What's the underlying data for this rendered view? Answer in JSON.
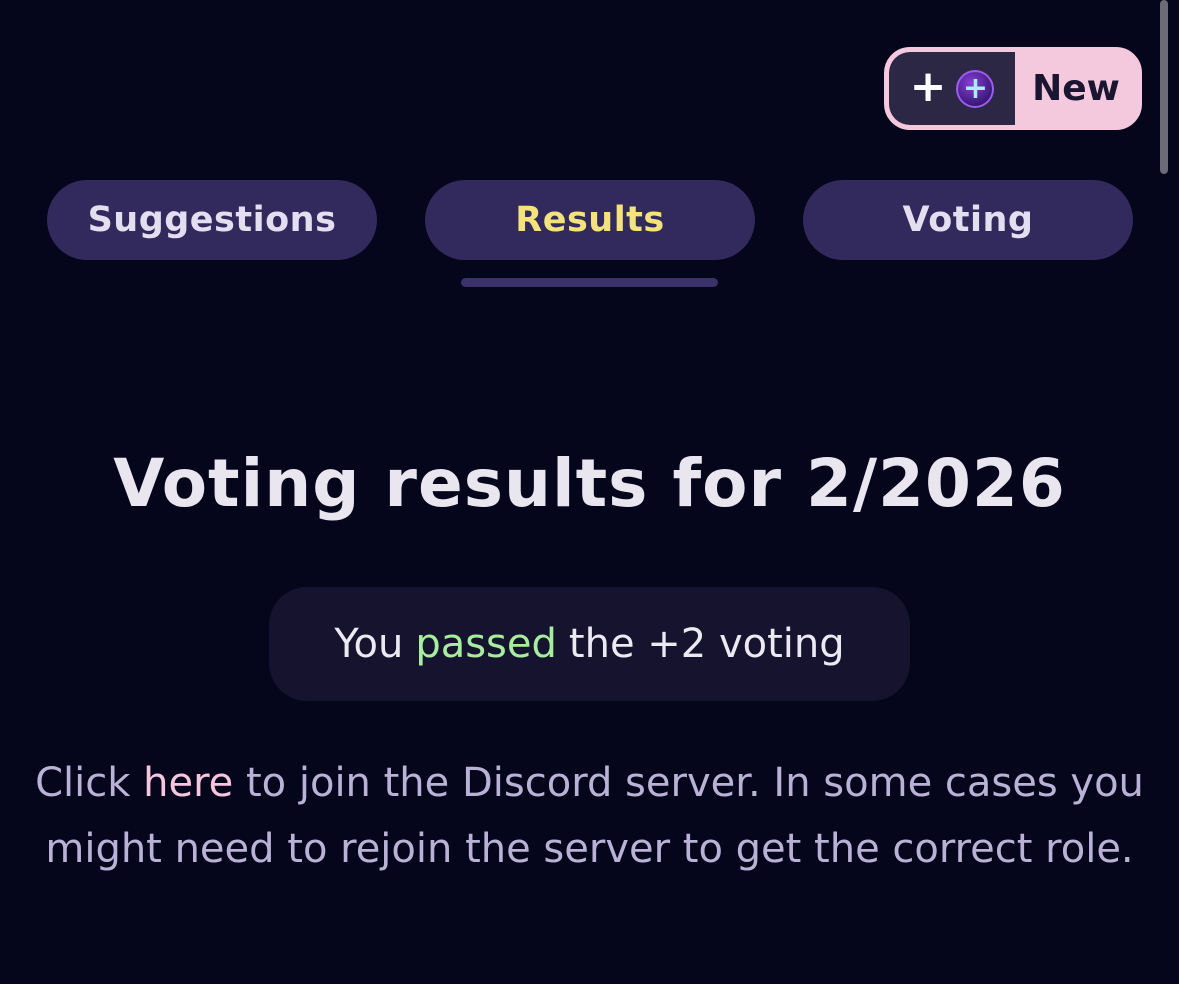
{
  "new_button": {
    "label": "New",
    "icons": [
      "plus-icon",
      "plus-circle-icon"
    ]
  },
  "tabs": [
    {
      "label": "Suggestions",
      "active": false
    },
    {
      "label": "Results",
      "active": true
    },
    {
      "label": "Voting",
      "active": false
    }
  ],
  "heading": "Voting results for 2/2026",
  "result": {
    "prefix": "You",
    "status": "passed",
    "suffix": "the +2 voting"
  },
  "info": {
    "before_link": "Click",
    "link": "here",
    "after_link": "to join the Discord server. In some cases you might need to rejoin the server to get the correct role."
  },
  "colors": {
    "background": "#05051c",
    "tab": "#322a5c",
    "active_tab_text": "#f3e37a",
    "passed": "#a7eda0",
    "link": "#f6c6de",
    "new_button": "#f4c8dd"
  }
}
